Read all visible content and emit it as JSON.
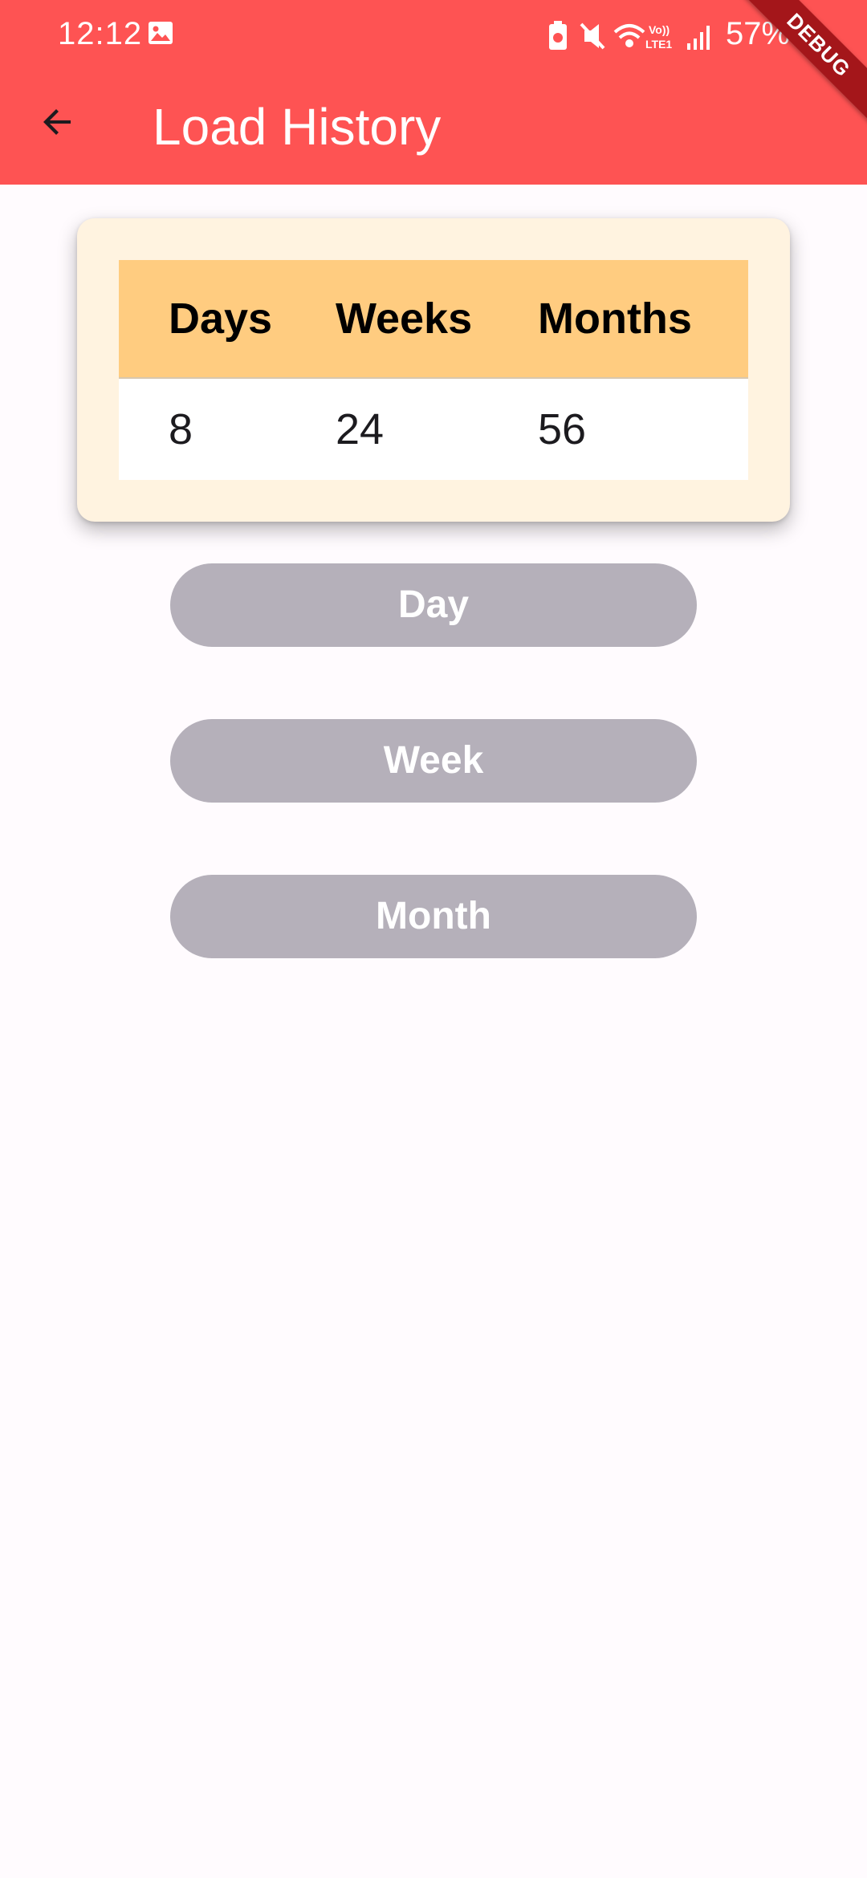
{
  "status_bar": {
    "time": "12:12",
    "battery": "57%",
    "network_label": "Vo)) LTE1"
  },
  "app_bar": {
    "title": "Load History",
    "back_icon": "arrow-back-icon"
  },
  "debug_banner": "DEBUG",
  "summary_table": {
    "headers": [
      "Days",
      "Weeks",
      "Months"
    ],
    "values": [
      "8",
      "24",
      "56"
    ]
  },
  "buttons": {
    "day": "Day",
    "week": "Week",
    "month": "Month"
  },
  "colors": {
    "app_bar": "#fe5353",
    "card_background": "#fff3e0",
    "table_header": "#ffcc80",
    "button_background": "#b5b0ba",
    "page_background": "#fffbfe",
    "debug_ribbon": "#a4161a"
  }
}
